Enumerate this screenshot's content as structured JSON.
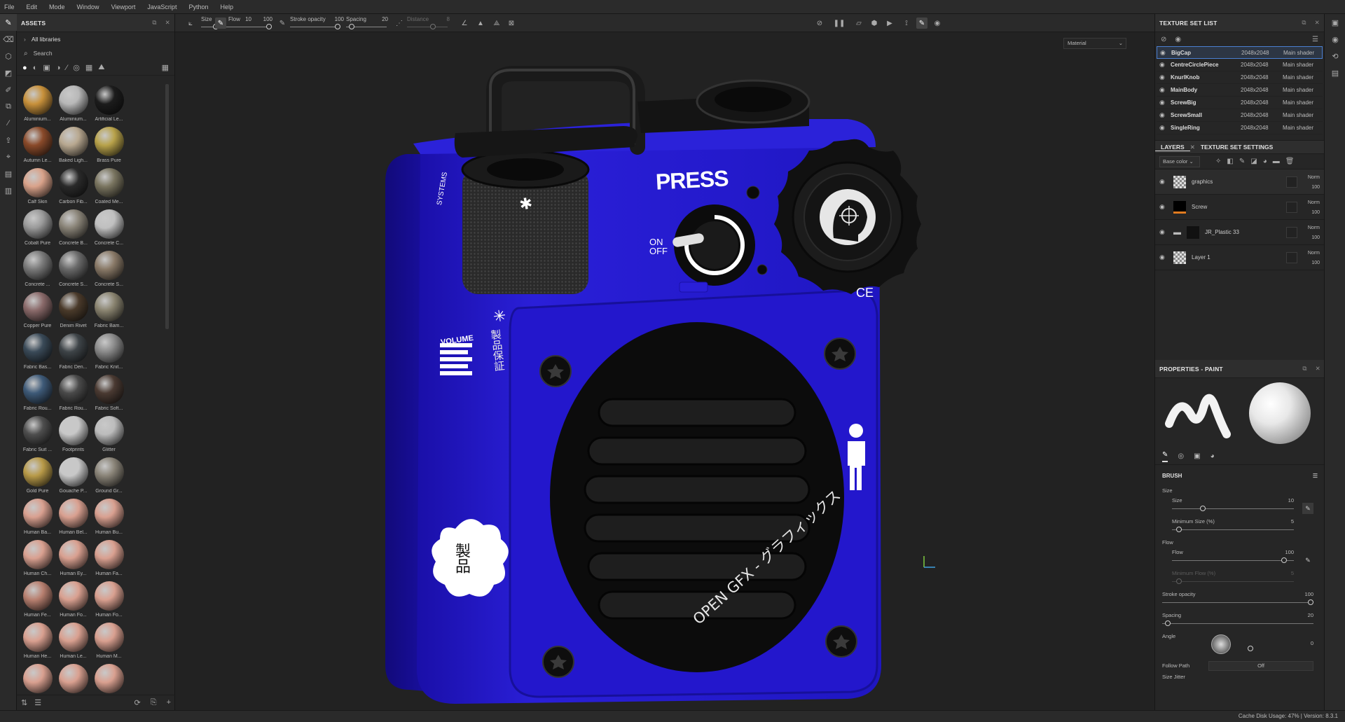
{
  "menu": [
    "File",
    "Edit",
    "Mode",
    "Window",
    "Viewport",
    "JavaScript",
    "Python",
    "Help"
  ],
  "assets": {
    "title": "ASSETS",
    "library": "All libraries",
    "search_placeholder": "Search",
    "items": [
      {
        "label": "Aluminium...",
        "color": "#c8913b"
      },
      {
        "label": "Aluminium...",
        "color": "#b8b8b8"
      },
      {
        "label": "Artificial Le...",
        "color": "#1c1c1c"
      },
      {
        "label": "Autumn Le...",
        "color": "#8a4a2a"
      },
      {
        "label": "Baked Ligh...",
        "color": "#b8a890"
      },
      {
        "label": "Brass Pure",
        "color": "#b8a24a"
      },
      {
        "label": "Calf Skin",
        "color": "#d9a28a"
      },
      {
        "label": "Carbon Fib...",
        "color": "#2a2a2a"
      },
      {
        "label": "Coated Me...",
        "color": "#7a7560"
      },
      {
        "label": "Cobalt Pure",
        "color": "#9a9a9a"
      },
      {
        "label": "Concrete B...",
        "color": "#8a8478"
      },
      {
        "label": "Concrete C...",
        "color": "#c0c0c0"
      },
      {
        "label": "Concrete ...",
        "color": "#7a7a7a"
      },
      {
        "label": "Concrete S...",
        "color": "#6a6a6a"
      },
      {
        "label": "Concrete S...",
        "color": "#8a7a68"
      },
      {
        "label": "Copper Pure",
        "color": "#8a6a6a"
      },
      {
        "label": "Denim Rivet",
        "color": "#4a3a2a"
      },
      {
        "label": "Fabric Bam...",
        "color": "#8a8470"
      },
      {
        "label": "Fabric Bas...",
        "color": "#3a4a58"
      },
      {
        "label": "Fabric Den...",
        "color": "#3e4448"
      },
      {
        "label": "Fabric Knit...",
        "color": "#8a8a8a"
      },
      {
        "label": "Fabric Rou...",
        "color": "#3e5a78"
      },
      {
        "label": "Fabric Rou...",
        "color": "#4a4a4a"
      },
      {
        "label": "Fabric Soft...",
        "color": "#4a3a32"
      },
      {
        "label": "Fabric Suit ...",
        "color": "#4e4e4e"
      },
      {
        "label": "Footprints",
        "color": "#c8c8c8"
      },
      {
        "label": "Glitter",
        "color": "#bcbcbc"
      },
      {
        "label": "Gold Pure",
        "color": "#b89a48"
      },
      {
        "label": "Gouache P...",
        "color": "#c8c8c8"
      },
      {
        "label": "Ground Gr...",
        "color": "#8a8478"
      },
      {
        "label": "Human Ba...",
        "color": "#d9a090"
      },
      {
        "label": "Human Bel...",
        "color": "#d9a090"
      },
      {
        "label": "Human Bu...",
        "color": "#d9a090"
      },
      {
        "label": "Human Ch...",
        "color": "#d9a090"
      },
      {
        "label": "Human Ey...",
        "color": "#d9a090"
      },
      {
        "label": "Human Fa...",
        "color": "#d9a090"
      },
      {
        "label": "Human Fe...",
        "color": "#b88070"
      },
      {
        "label": "Human Fo...",
        "color": "#d9a090"
      },
      {
        "label": "Human Fo...",
        "color": "#d9a090"
      },
      {
        "label": "Human He...",
        "color": "#d9a090"
      },
      {
        "label": "Human Le...",
        "color": "#d9a090"
      },
      {
        "label": "Human M...",
        "color": "#d9a090"
      },
      {
        "label": "",
        "color": "#d9a090"
      },
      {
        "label": "",
        "color": "#d9a090"
      },
      {
        "label": "",
        "color": "#d9a090"
      }
    ]
  },
  "toolbar": {
    "size_label": "Size",
    "size_value": "10",
    "flow_label": "Flow",
    "flow_value": "100",
    "stroke_opacity_label": "Stroke opacity",
    "stroke_opacity_value": "100",
    "spacing_label": "Spacing",
    "spacing_value": "20",
    "distance_label": "Distance",
    "distance_value": "8"
  },
  "viewport": {
    "material_select": "Material"
  },
  "texture_set_list": {
    "title": "TEXTURE SET LIST",
    "rows": [
      {
        "name": "BigCap",
        "res": "2048x2048",
        "shader": "Main shader"
      },
      {
        "name": "CentreCirclePiece",
        "res": "2048x2048",
        "shader": "Main shader"
      },
      {
        "name": "KnurlKnob",
        "res": "2048x2048",
        "shader": "Main shader"
      },
      {
        "name": "MainBody",
        "res": "2048x2048",
        "shader": "Main shader"
      },
      {
        "name": "ScrewBig",
        "res": "2048x2048",
        "shader": "Main shader"
      },
      {
        "name": "ScrewSmall",
        "res": "2048x2048",
        "shader": "Main shader"
      },
      {
        "name": "SingleRing",
        "res": "2048x2048",
        "shader": "Main shader"
      }
    ]
  },
  "layers_panel": {
    "tab_layers": "LAYERS",
    "tab_settings": "TEXTURE SET SETTINGS",
    "channel": "Base color",
    "layers": [
      {
        "name": "graphics",
        "blend": "Norm",
        "opacity": "100"
      },
      {
        "name": "Screw",
        "blend": "Norm",
        "opacity": "100"
      },
      {
        "name": "JR_Plastic 33",
        "blend": "Norm",
        "opacity": "100"
      },
      {
        "name": "Layer 1",
        "blend": "Norm",
        "opacity": "100"
      }
    ]
  },
  "properties": {
    "title": "PROPERTIES - PAINT",
    "brush_title": "BRUSH",
    "size_group": "Size",
    "size_label": "Size",
    "size_value": "10",
    "min_size_label": "Minimum Size (%)",
    "min_size_value": "5",
    "flow_group": "Flow",
    "flow_label": "Flow",
    "flow_value": "100",
    "min_flow_label": "Minimum Flow (%)",
    "min_flow_value": "5",
    "stroke_opacity_label": "Stroke opacity",
    "stroke_opacity_value": "100",
    "spacing_label": "Spacing",
    "spacing_value": "20",
    "angle_label": "Angle",
    "angle_value": "0",
    "follow_path_label": "Follow Path",
    "follow_path_value": "Off",
    "size_jitter_label": "Size Jitter"
  },
  "model_text": {
    "press": "PRESS",
    "on": "ON",
    "off": "OFF",
    "volume": "VOLUME",
    "systems": "SYSTEMS",
    "ce": "CE",
    "seihin": "製品",
    "ring": "OPEN GFX - グラフィックス",
    "kanji_side": "製品保証"
  },
  "status": {
    "text": "Cache Disk Usage:   47%  |  Version: 8.3.1"
  },
  "colors": {
    "accent": "#4a7fd1",
    "body_blue": "#1f14c9",
    "speaker": "#0c0c0c"
  }
}
